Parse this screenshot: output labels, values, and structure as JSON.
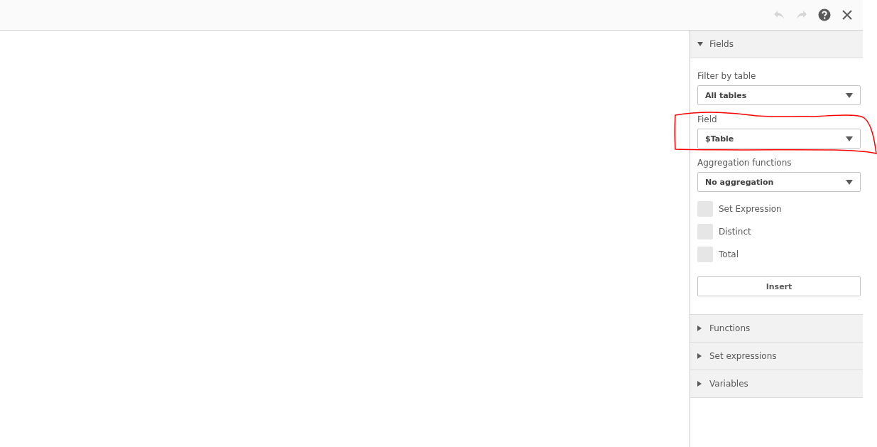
{
  "toolbar": {
    "undo": {
      "disabled": true
    },
    "redo": {
      "disabled": true
    }
  },
  "panel": {
    "sections": [
      {
        "kind": "fields",
        "title": "Fields",
        "expanded": true,
        "dropdowns": [
          {
            "label": "Filter by table",
            "value": "All tables"
          },
          {
            "label": "Field",
            "value": "$Table"
          },
          {
            "label": "Aggregation functions",
            "value": "No aggregation"
          }
        ],
        "checkboxes": [
          {
            "label": "Set Expression",
            "checked": false
          },
          {
            "label": "Distinct",
            "checked": false
          },
          {
            "label": "Total",
            "checked": false
          }
        ],
        "button": "Insert"
      },
      {
        "kind": "plain",
        "title": "Functions",
        "expanded": false
      },
      {
        "kind": "plain",
        "title": "Set expressions",
        "expanded": false
      },
      {
        "kind": "plain",
        "title": "Variables",
        "expanded": false
      }
    ]
  },
  "annotation": {
    "kind": "freehand-outline",
    "color": "#ff0000"
  }
}
